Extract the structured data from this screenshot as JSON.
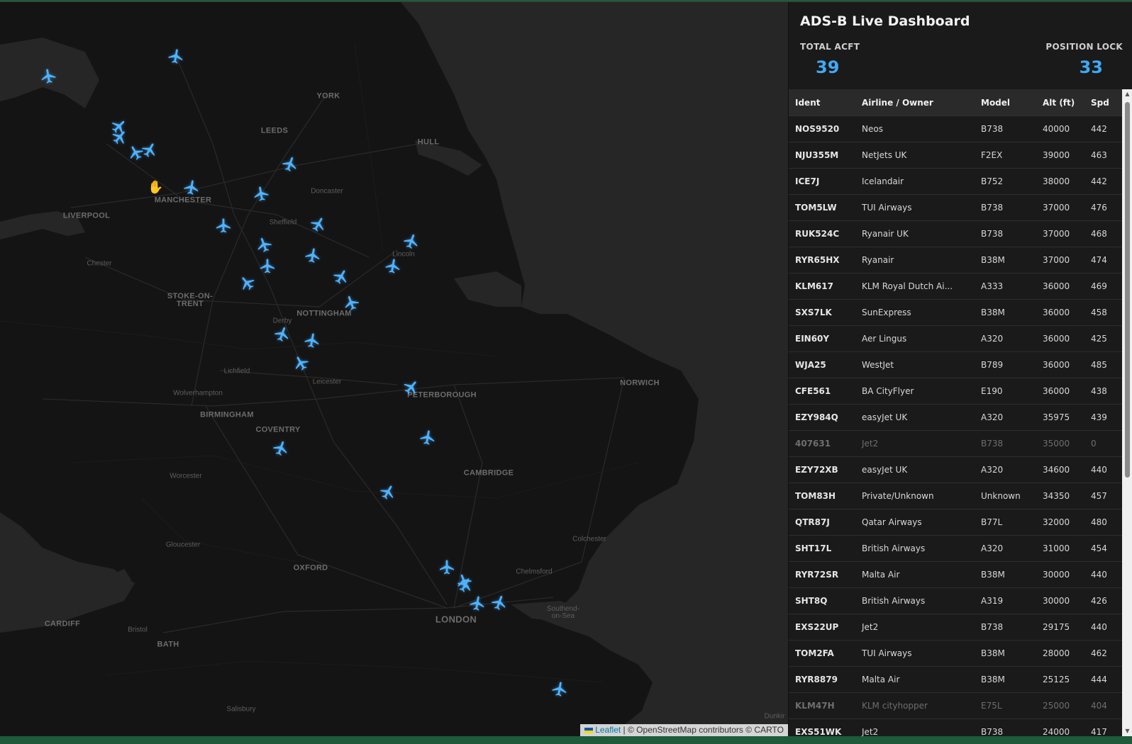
{
  "dashboard": {
    "title": "ADS-B Live Dashboard",
    "total_label": "TOTAL ACFT",
    "total_value": "39",
    "lock_label": "POSITION LOCK",
    "lock_value": "33"
  },
  "table": {
    "headers": [
      "Ident",
      "Airline / Owner",
      "Model",
      "Alt (ft)",
      "Spd"
    ],
    "rows": [
      {
        "ident": "NOS9520",
        "airline": "Neos",
        "model": "B738",
        "alt": "40000",
        "spd": "442",
        "position": true
      },
      {
        "ident": "NJU355M",
        "airline": "NetJets UK",
        "model": "F2EX",
        "alt": "39000",
        "spd": "463",
        "position": true
      },
      {
        "ident": "ICE7J",
        "airline": "Icelandair",
        "model": "B752",
        "alt": "38000",
        "spd": "442",
        "position": true
      },
      {
        "ident": "TOM5LW",
        "airline": "TUI Airways",
        "model": "B738",
        "alt": "37000",
        "spd": "476",
        "position": true
      },
      {
        "ident": "RUK524C",
        "airline": "Ryanair UK",
        "model": "B738",
        "alt": "37000",
        "spd": "468",
        "position": true
      },
      {
        "ident": "RYR65HX",
        "airline": "Ryanair",
        "model": "B38M",
        "alt": "37000",
        "spd": "474",
        "position": true
      },
      {
        "ident": "KLM617",
        "airline": "KLM Royal Dutch Ai...",
        "model": "A333",
        "alt": "36000",
        "spd": "469",
        "position": true
      },
      {
        "ident": "SXS7LK",
        "airline": "SunExpress",
        "model": "B38M",
        "alt": "36000",
        "spd": "458",
        "position": true
      },
      {
        "ident": "EIN60Y",
        "airline": "Aer Lingus",
        "model": "A320",
        "alt": "36000",
        "spd": "425",
        "position": true
      },
      {
        "ident": "WJA25",
        "airline": "WestJet",
        "model": "B789",
        "alt": "36000",
        "spd": "485",
        "position": true
      },
      {
        "ident": "CFE561",
        "airline": "BA CityFlyer",
        "model": "E190",
        "alt": "36000",
        "spd": "438",
        "position": true
      },
      {
        "ident": "EZY984Q",
        "airline": "easyJet UK",
        "model": "A320",
        "alt": "35975",
        "spd": "439",
        "position": true
      },
      {
        "ident": "407631",
        "airline": "Jet2",
        "model": "B738",
        "alt": "35000",
        "spd": "0",
        "position": false
      },
      {
        "ident": "EZY72XB",
        "airline": "easyJet UK",
        "model": "A320",
        "alt": "34600",
        "spd": "440",
        "position": true
      },
      {
        "ident": "TOM83H",
        "airline": "Private/Unknown",
        "model": "Unknown",
        "alt": "34350",
        "spd": "457",
        "position": true
      },
      {
        "ident": "QTR87J",
        "airline": "Qatar Airways",
        "model": "B77L",
        "alt": "32000",
        "spd": "480",
        "position": true
      },
      {
        "ident": "SHT17L",
        "airline": "British Airways",
        "model": "A320",
        "alt": "31000",
        "spd": "454",
        "position": true
      },
      {
        "ident": "RYR72SR",
        "airline": "Malta Air",
        "model": "B38M",
        "alt": "30000",
        "spd": "440",
        "position": true
      },
      {
        "ident": "SHT8Q",
        "airline": "British Airways",
        "model": "A319",
        "alt": "30000",
        "spd": "426",
        "position": true
      },
      {
        "ident": "EXS22UP",
        "airline": "Jet2",
        "model": "B738",
        "alt": "29175",
        "spd": "440",
        "position": true
      },
      {
        "ident": "TOM2FA",
        "airline": "TUI Airways",
        "model": "B38M",
        "alt": "28000",
        "spd": "462",
        "position": true
      },
      {
        "ident": "RYR8879",
        "airline": "Malta Air",
        "model": "B38M",
        "alt": "25125",
        "spd": "444",
        "position": true
      },
      {
        "ident": "KLM47H",
        "airline": "KLM cityhopper",
        "model": "E75L",
        "alt": "25000",
        "spd": "404",
        "position": false
      },
      {
        "ident": "EXS51WK",
        "airline": "Jet2",
        "model": "B738",
        "alt": "24000",
        "spd": "417",
        "position": true
      }
    ]
  },
  "map": {
    "cities": [
      "YORK",
      "LEEDS",
      "HULL",
      "MANCHESTER",
      "LIVERPOOL",
      "STOKE-ON-TRENT",
      "NOTTINGHAM",
      "PETERBOROUGH",
      "NORWICH",
      "BIRMINGHAM",
      "COVENTRY",
      "CAMBRIDGE",
      "OXFORD",
      "LONDON",
      "CARDIFF",
      "BATH"
    ],
    "towns": [
      "Doncaster",
      "Sheffield",
      "Lincoln",
      "Chester",
      "Derby",
      "Lichfield",
      "Leicester",
      "Wolverhampton",
      "Worcester",
      "Gloucester",
      "Colchester",
      "Chelmsford",
      "Southend-on-Sea",
      "Bristol",
      "Salisbury",
      "Dunkir"
    ],
    "attribution_link": "Leaflet",
    "attribution_text": " | © OpenStreetMap contributors © CARTO",
    "plane_icon": "airplane-icon",
    "plane_color": "#4fb3ff",
    "cursor_icon": "hand-cursor-icon"
  }
}
